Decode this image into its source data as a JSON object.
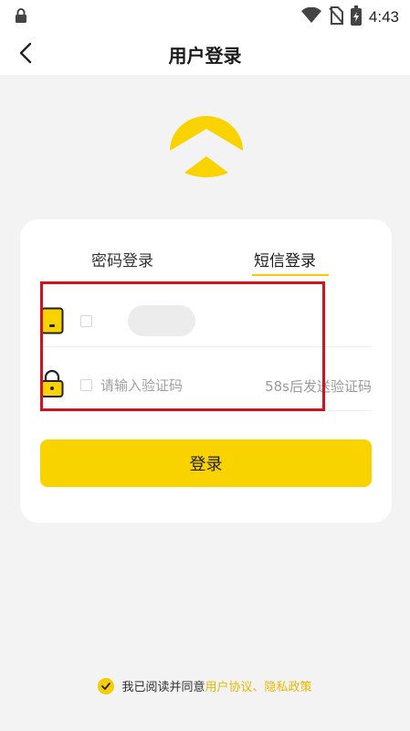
{
  "status_bar": {
    "time": "4:43",
    "icons": [
      "lock-icon",
      "wifi-icon",
      "no-sim-icon",
      "battery-icon"
    ]
  },
  "nav": {
    "title": "用户登录",
    "back_icon": "back-arrow-icon"
  },
  "logo": {
    "icon": "logo-chevron-icon",
    "color": "#f8d300"
  },
  "tabs": [
    {
      "label": "密码登录",
      "active": false
    },
    {
      "label": "短信登录",
      "active": true
    }
  ],
  "form": {
    "phone_icon": "phone-icon",
    "code_icon": "padlock-icon",
    "code_placeholder": "请输入验证码",
    "send_code_label": "58s后发送验证码"
  },
  "login_button": {
    "label": "登录"
  },
  "agreement": {
    "prefix": "我已阅读并同意",
    "user_agreement": "用户协议",
    "separator": "、",
    "privacy_policy": "隐私政策",
    "checked": true
  },
  "colors": {
    "accent": "#f8d300",
    "highlight": "#d0141c",
    "link": "#e8b800"
  }
}
